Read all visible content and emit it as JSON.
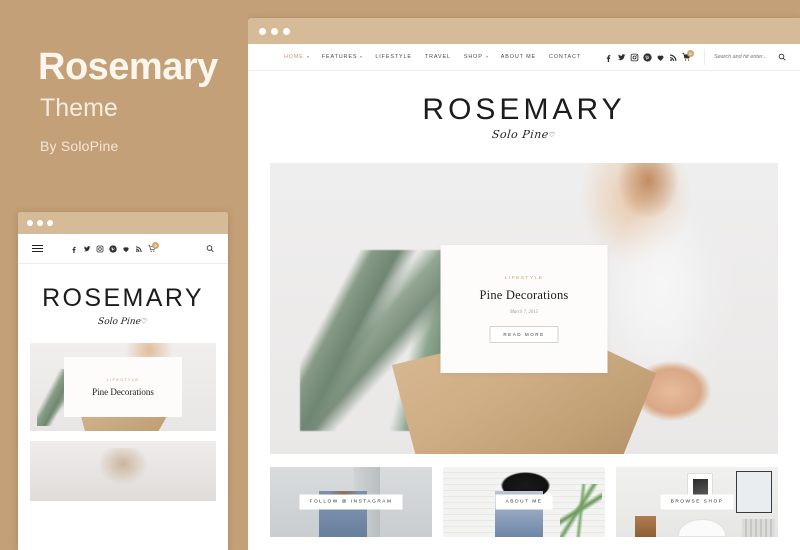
{
  "promo": {
    "title": "Rosemary",
    "subtitle": "Theme",
    "author": "By SoloPine"
  },
  "colors": {
    "background": "#c4a078",
    "titlebar": "#d6bb99",
    "accent": "#c2a274",
    "nav_active": "#c79a6a"
  },
  "desktop": {
    "nav": {
      "items": [
        {
          "label": "HOME",
          "has_dropdown": true,
          "active": true
        },
        {
          "label": "FEATURES",
          "has_dropdown": true,
          "active": false
        },
        {
          "label": "LIFESTYLE",
          "has_dropdown": false,
          "active": false
        },
        {
          "label": "TRAVEL",
          "has_dropdown": false,
          "active": false
        },
        {
          "label": "SHOP",
          "has_dropdown": true,
          "active": false
        },
        {
          "label": "ABOUT ME",
          "has_dropdown": false,
          "active": false
        },
        {
          "label": "CONTACT",
          "has_dropdown": false,
          "active": false
        }
      ],
      "social": [
        "facebook-icon",
        "twitter-icon",
        "instagram-icon",
        "pinterest-icon",
        "bloglovin-heart-icon",
        "rss-icon"
      ],
      "cart": {
        "icon": "shopping-cart-icon",
        "count": "0"
      },
      "search": {
        "placeholder": "Search and hit enter...",
        "value": "",
        "icon": "search-icon"
      }
    },
    "logo": {
      "word": "ROSEMARY",
      "script": "Solo Pine",
      "heart": "♡"
    },
    "hero": {
      "category": "LIFESTYLE",
      "title": "Pine Decorations",
      "date": "March 7, 2015",
      "button": "READ MORE"
    },
    "promo_cards": [
      {
        "label": "FOLLOW @ INSTAGRAM"
      },
      {
        "label": "ABOUT ME"
      },
      {
        "label": "BROWSE SHOP"
      }
    ]
  },
  "mobile": {
    "menu_icon": "hamburger-menu-icon",
    "social": [
      "facebook-icon",
      "twitter-icon",
      "instagram-icon",
      "pinterest-icon",
      "bloglovin-heart-icon",
      "rss-icon"
    ],
    "cart": {
      "icon": "shopping-cart-icon",
      "count": "0"
    },
    "search_icon": "search-icon",
    "logo": {
      "word": "ROSEMARY",
      "script": "Solo Pine",
      "heart": "♡"
    },
    "hero": {
      "category": "LIFESTYLE",
      "title": "Pine Decorations"
    }
  }
}
